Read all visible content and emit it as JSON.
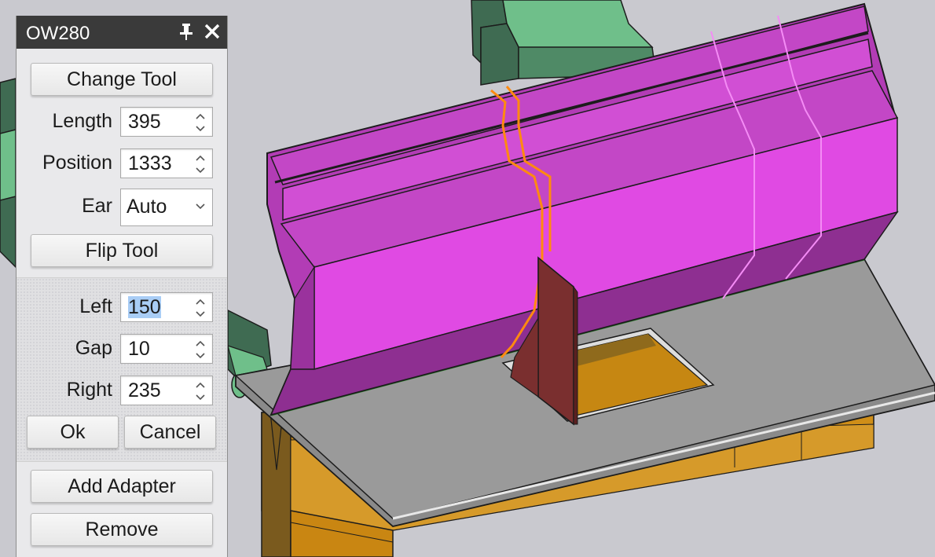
{
  "panel": {
    "title": "OW280",
    "change_tool": "Change Tool",
    "fields": {
      "length": {
        "label": "Length",
        "value": "395"
      },
      "position": {
        "label": "Position",
        "value": "1333"
      },
      "ear": {
        "label": "Ear",
        "value": "Auto"
      }
    },
    "flip_tool": "Flip Tool",
    "split": {
      "left": {
        "label": "Left",
        "value": "150"
      },
      "gap": {
        "label": "Gap",
        "value": "10"
      },
      "right": {
        "label": "Right",
        "value": "235"
      },
      "ok": "Ok",
      "cancel": "Cancel"
    },
    "add_adapter": "Add Adapter",
    "remove": "Remove"
  },
  "icons": {
    "pin": "pin-icon",
    "close": "close-icon",
    "spin": "spin-arrows-icon",
    "chevron": "chevron-down-icon"
  },
  "colors": {
    "tool_magenta": "#e04ae3",
    "tool_magenta_dark": "#b23cb5",
    "sheet_gray": "#8a8a8a",
    "die_orange": "#cf8e18",
    "flange_red": "#7a2f2f",
    "split_line_orange": "#ff8a10",
    "holder_green": "#6fbf8a",
    "title_bar": "#3a3a3a"
  }
}
